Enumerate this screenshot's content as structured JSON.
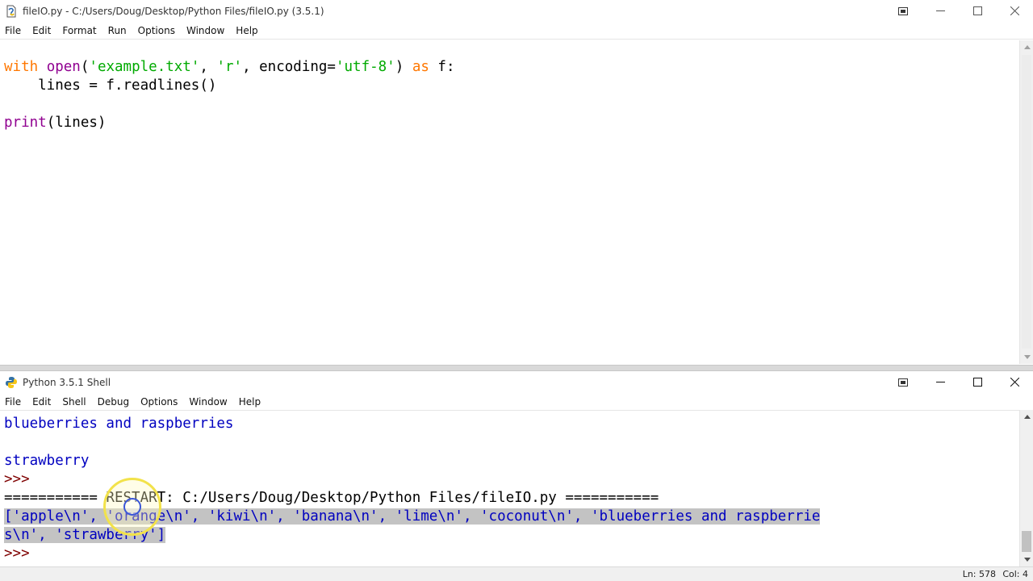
{
  "editor": {
    "title": "fileIO.py - C:/Users/Doug/Desktop/Python Files/fileIO.py (3.5.1)",
    "menu": [
      "File",
      "Edit",
      "Format",
      "Run",
      "Options",
      "Window",
      "Help"
    ],
    "code": {
      "line1": {
        "kw1": "with",
        "sp1": " ",
        "fn": "open",
        "p1": "(",
        "s1": "'example.txt'",
        "c1": ", ",
        "s2": "'r'",
        "c2": ", encoding=",
        "s3": "'utf-8'",
        "p2": ") ",
        "kw2": "as",
        "rest": " f:"
      },
      "line2": "    lines = f.readlines()",
      "line4": {
        "fn": "print",
        "rest": "(lines)"
      }
    }
  },
  "shell": {
    "title": "Python 3.5.1 Shell",
    "menu": [
      "File",
      "Edit",
      "Shell",
      "Debug",
      "Options",
      "Window",
      "Help"
    ],
    "lines": {
      "out1": "blueberries and raspberries",
      "out2": "strawberry",
      "prompt1": ">>>",
      "restart": "=========== RESTART: C:/Users/Doug/Desktop/Python Files/fileIO.py ===========",
      "result1": "['apple\\n', 'orange\\n', 'kiwi\\n', 'banana\\n', 'lime\\n', 'coconut\\n', 'blueberries and raspberrie",
      "result2": "s\\n', 'strawberry']",
      "prompt2": ">>>"
    },
    "status": {
      "ln": "Ln: 578",
      "col": "Col: 4"
    }
  }
}
